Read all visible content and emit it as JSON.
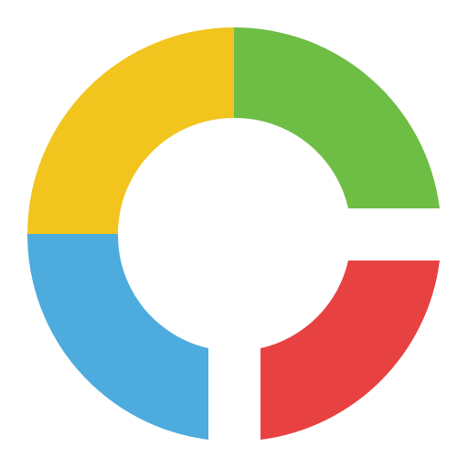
{
  "logo": {
    "icon": "four-color-ring-logo-icon",
    "colors": {
      "green": "#6EBD45",
      "red": "#E84142",
      "blue": "#4DABDD",
      "yellow": "#F2C41E",
      "background": "#FFFFFF"
    }
  }
}
